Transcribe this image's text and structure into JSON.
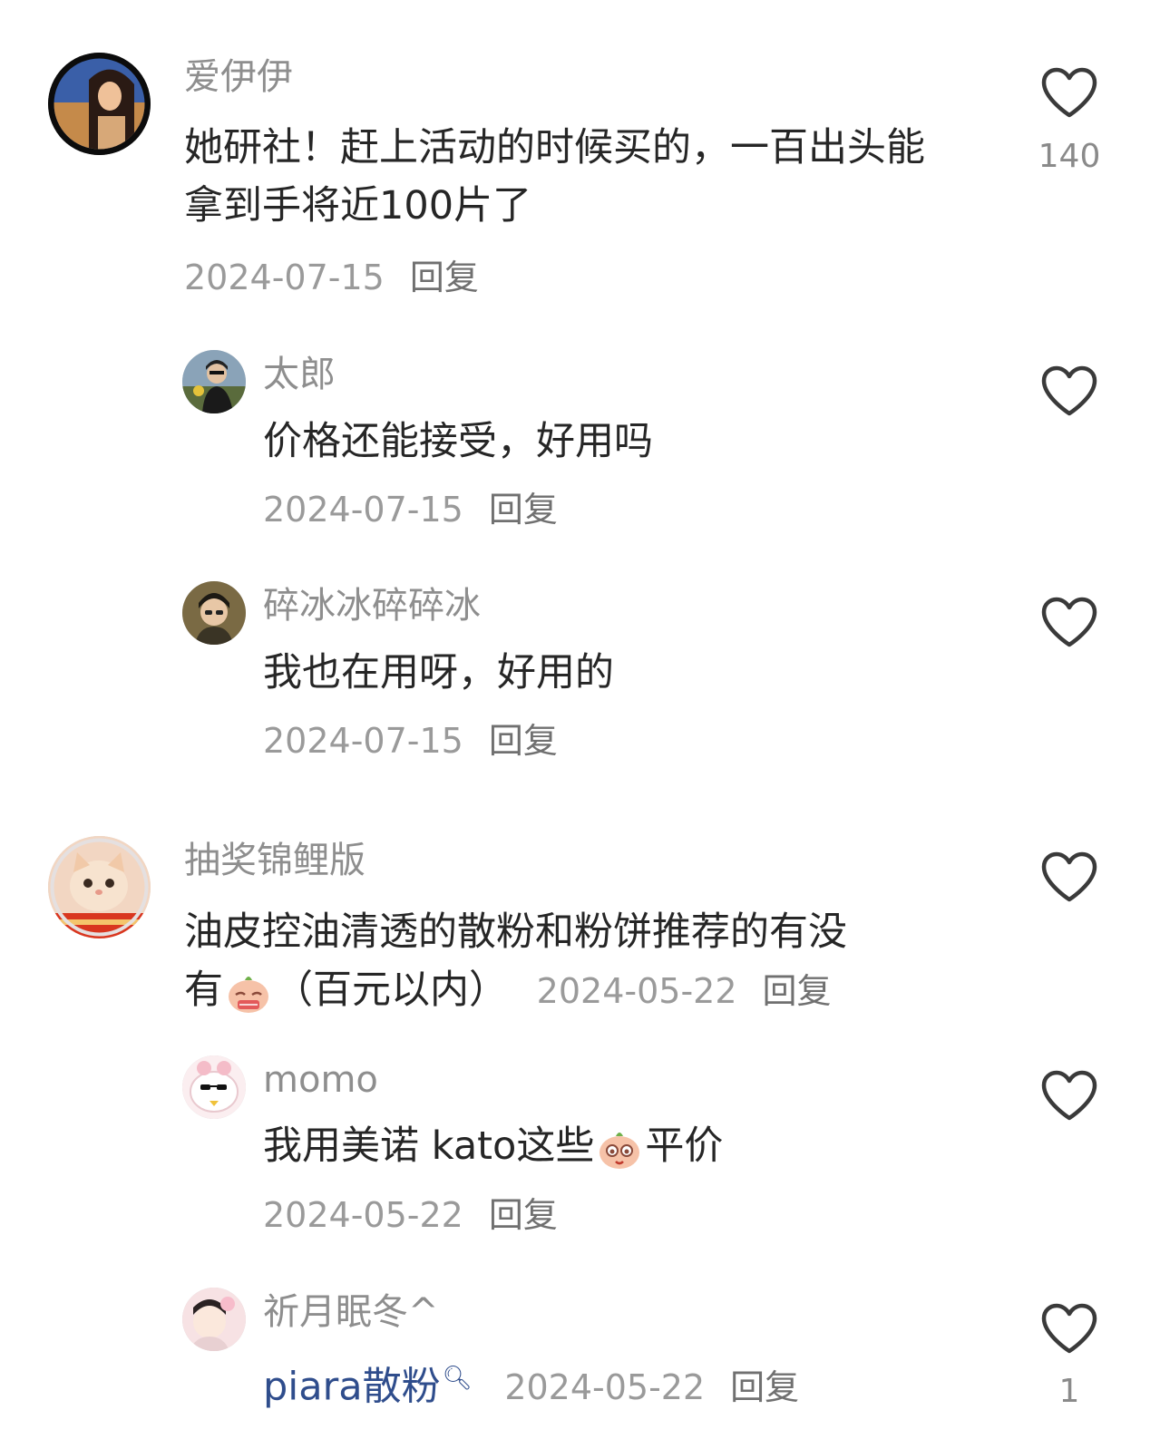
{
  "comments": [
    {
      "username": "爱伊伊",
      "text": "她研社！赶上活动的时候买的，一百出头能拿到手将近100片了",
      "date": "2024-07-15",
      "reply": "回复",
      "likes": "140"
    },
    {
      "username": "太郎",
      "text": "价格还能接受，好用吗",
      "date": "2024-07-15",
      "reply": "回复",
      "likes": ""
    },
    {
      "username": "碎冰冰碎碎冰",
      "text": "我也在用呀，好用的",
      "date": "2024-07-15",
      "reply": "回复",
      "likes": ""
    },
    {
      "username": "抽奖锦鲤版",
      "text_line1": "油皮控油清透的散粉和粉饼推荐的有没",
      "text_line2_pre": "有",
      "emoji1": "shy-face-emoji",
      "text_line2_post": "（百元以内）",
      "date": "2024-05-22",
      "reply": "回复",
      "likes": ""
    },
    {
      "username": "momo",
      "text_pre": "我用美诺 kato这些",
      "emoji2": "smiling-face-emoji",
      "text_post": "平价",
      "date": "2024-05-22",
      "reply": "回复",
      "likes": ""
    },
    {
      "username": "祈月眠冬^",
      "link": "piara散粉",
      "date": "2024-05-22",
      "reply": "回复",
      "likes": "1"
    }
  ],
  "icons": {
    "like": "heart-outline-icon",
    "search": "search-icon"
  },
  "colors": {
    "username": "#8e8e8e",
    "text": "#262626",
    "meta": "#9a9a9a",
    "link": "#2f4d8c"
  }
}
